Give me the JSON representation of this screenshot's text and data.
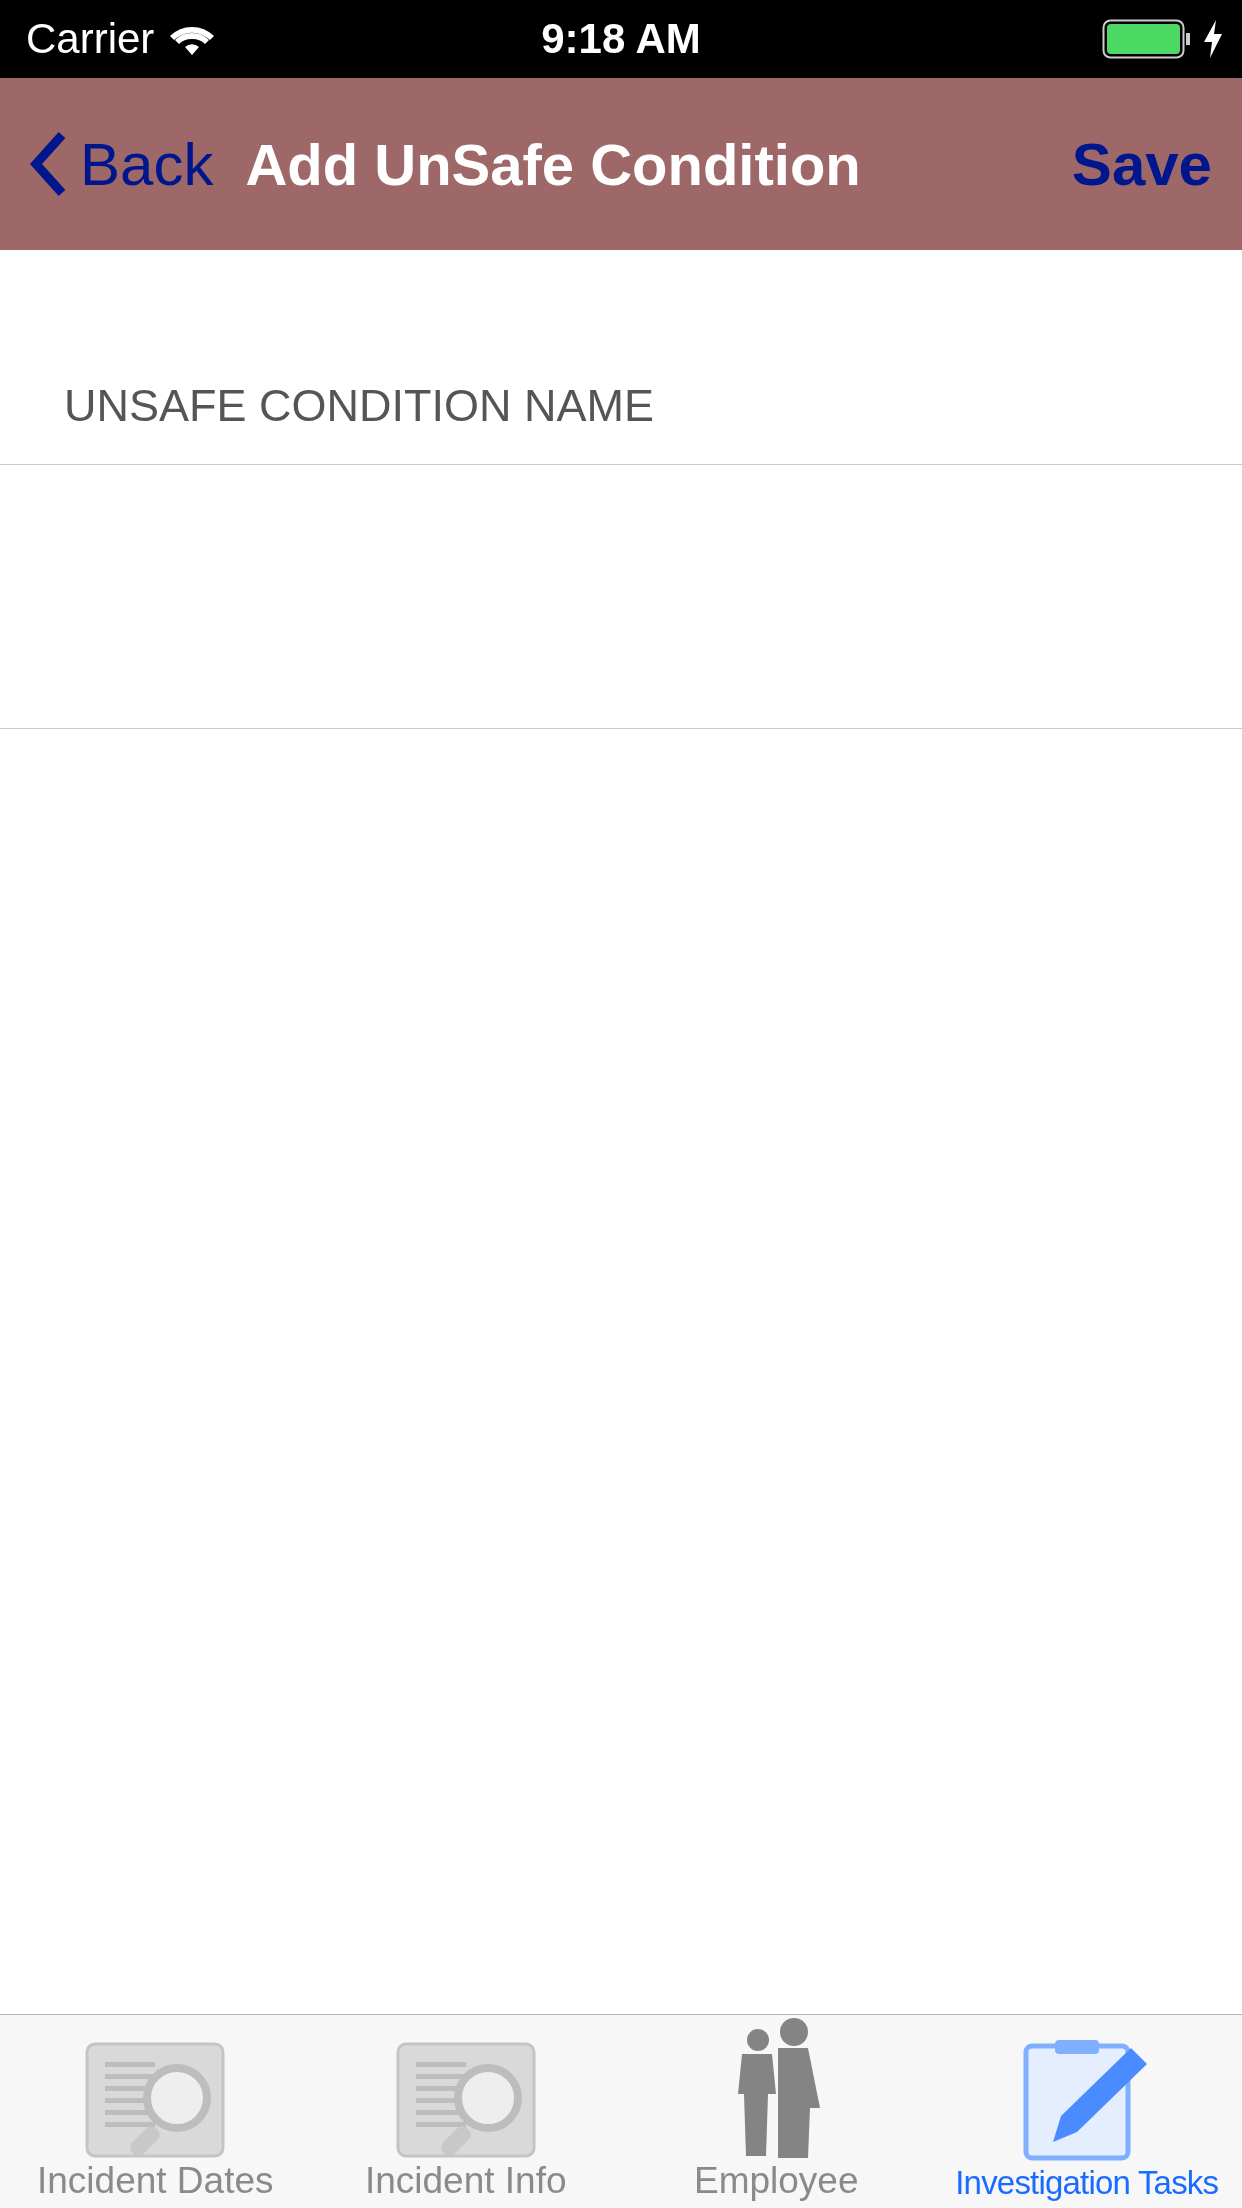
{
  "status_bar": {
    "carrier": "Carrier",
    "time": "9:18 AM"
  },
  "nav_bar": {
    "back": "Back",
    "title": "Add UnSafe Condition",
    "action": "Save"
  },
  "form": {
    "section_header": "UNSAFE CONDITION NAME"
  },
  "tabs": [
    {
      "label": "Incident Dates",
      "kind": "report",
      "selected": false
    },
    {
      "label": "Incident Info",
      "kind": "report",
      "selected": false
    },
    {
      "label": "Employee",
      "kind": "people",
      "selected": false
    },
    {
      "label": "Investigation Tasks",
      "kind": "clipboard",
      "selected": true
    }
  ]
}
